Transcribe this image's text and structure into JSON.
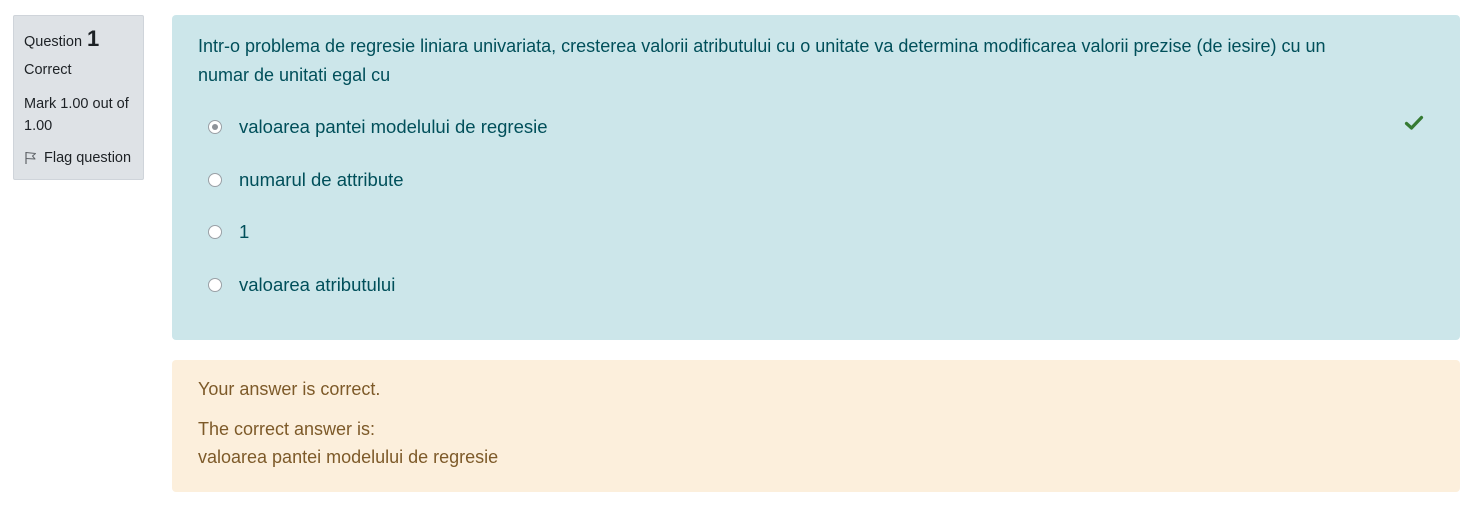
{
  "info": {
    "question_label": "Question",
    "question_number": "1",
    "state": "Correct",
    "grade": "Mark 1.00 out of 1.00",
    "flag_label": "Flag question"
  },
  "question": {
    "text": "Intr-o problema de regresie liniara univariata, cresterea valorii atributului cu o unitate va determina modificarea valorii prezise (de iesire) cu un numar de unitati egal cu",
    "answers": [
      {
        "label": "valoarea pantei modelului de regresie",
        "selected": true
      },
      {
        "label": "numarul de attribute",
        "selected": false
      },
      {
        "label": "1",
        "selected": false
      },
      {
        "label": "valoarea atributului",
        "selected": false
      }
    ],
    "correct_icon": "checkmark-icon"
  },
  "feedback": {
    "message": "Your answer is correct.",
    "correct_answer_intro": "The correct answer is:",
    "correct_answer": "valoarea pantei modelului de regresie"
  },
  "colors": {
    "question_bg": "#cce6ea",
    "feedback_bg": "#fcefdc",
    "info_bg": "#dee2e6",
    "check_green": "#357a32"
  }
}
